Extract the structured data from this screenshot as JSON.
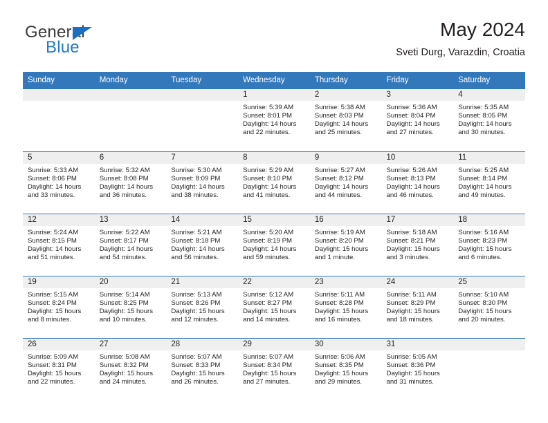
{
  "brand": {
    "name_part1": "General",
    "name_part2": "Blue",
    "triangle_icon": "blue-triangle-logo-mark",
    "color_dark": "#3b3b3b",
    "color_blue": "#2079c7"
  },
  "header": {
    "title": "May 2024",
    "subtitle": "Sveti Durg, Varazdin, Croatia"
  },
  "colors": {
    "header_blue": "#3478bc",
    "daynum_band": "#efefef",
    "text": "#231f20",
    "row_divider": "#3478bc"
  },
  "calendar": {
    "weekday_headers": [
      "Sunday",
      "Monday",
      "Tuesday",
      "Wednesday",
      "Thursday",
      "Friday",
      "Saturday"
    ],
    "weeks": [
      [
        {
          "day": "",
          "sunrise": "",
          "sunset": "",
          "daylight_line1": "",
          "daylight_line2": ""
        },
        {
          "day": "",
          "sunrise": "",
          "sunset": "",
          "daylight_line1": "",
          "daylight_line2": ""
        },
        {
          "day": "",
          "sunrise": "",
          "sunset": "",
          "daylight_line1": "",
          "daylight_line2": ""
        },
        {
          "day": "1",
          "sunrise": "Sunrise: 5:39 AM",
          "sunset": "Sunset: 8:01 PM",
          "daylight_line1": "Daylight: 14 hours",
          "daylight_line2": "and 22 minutes."
        },
        {
          "day": "2",
          "sunrise": "Sunrise: 5:38 AM",
          "sunset": "Sunset: 8:03 PM",
          "daylight_line1": "Daylight: 14 hours",
          "daylight_line2": "and 25 minutes."
        },
        {
          "day": "3",
          "sunrise": "Sunrise: 5:36 AM",
          "sunset": "Sunset: 8:04 PM",
          "daylight_line1": "Daylight: 14 hours",
          "daylight_line2": "and 27 minutes."
        },
        {
          "day": "4",
          "sunrise": "Sunrise: 5:35 AM",
          "sunset": "Sunset: 8:05 PM",
          "daylight_line1": "Daylight: 14 hours",
          "daylight_line2": "and 30 minutes."
        }
      ],
      [
        {
          "day": "5",
          "sunrise": "Sunrise: 5:33 AM",
          "sunset": "Sunset: 8:06 PM",
          "daylight_line1": "Daylight: 14 hours",
          "daylight_line2": "and 33 minutes."
        },
        {
          "day": "6",
          "sunrise": "Sunrise: 5:32 AM",
          "sunset": "Sunset: 8:08 PM",
          "daylight_line1": "Daylight: 14 hours",
          "daylight_line2": "and 36 minutes."
        },
        {
          "day": "7",
          "sunrise": "Sunrise: 5:30 AM",
          "sunset": "Sunset: 8:09 PM",
          "daylight_line1": "Daylight: 14 hours",
          "daylight_line2": "and 38 minutes."
        },
        {
          "day": "8",
          "sunrise": "Sunrise: 5:29 AM",
          "sunset": "Sunset: 8:10 PM",
          "daylight_line1": "Daylight: 14 hours",
          "daylight_line2": "and 41 minutes."
        },
        {
          "day": "9",
          "sunrise": "Sunrise: 5:27 AM",
          "sunset": "Sunset: 8:12 PM",
          "daylight_line1": "Daylight: 14 hours",
          "daylight_line2": "and 44 minutes."
        },
        {
          "day": "10",
          "sunrise": "Sunrise: 5:26 AM",
          "sunset": "Sunset: 8:13 PM",
          "daylight_line1": "Daylight: 14 hours",
          "daylight_line2": "and 46 minutes."
        },
        {
          "day": "11",
          "sunrise": "Sunrise: 5:25 AM",
          "sunset": "Sunset: 8:14 PM",
          "daylight_line1": "Daylight: 14 hours",
          "daylight_line2": "and 49 minutes."
        }
      ],
      [
        {
          "day": "12",
          "sunrise": "Sunrise: 5:24 AM",
          "sunset": "Sunset: 8:15 PM",
          "daylight_line1": "Daylight: 14 hours",
          "daylight_line2": "and 51 minutes."
        },
        {
          "day": "13",
          "sunrise": "Sunrise: 5:22 AM",
          "sunset": "Sunset: 8:17 PM",
          "daylight_line1": "Daylight: 14 hours",
          "daylight_line2": "and 54 minutes."
        },
        {
          "day": "14",
          "sunrise": "Sunrise: 5:21 AM",
          "sunset": "Sunset: 8:18 PM",
          "daylight_line1": "Daylight: 14 hours",
          "daylight_line2": "and 56 minutes."
        },
        {
          "day": "15",
          "sunrise": "Sunrise: 5:20 AM",
          "sunset": "Sunset: 8:19 PM",
          "daylight_line1": "Daylight: 14 hours",
          "daylight_line2": "and 59 minutes."
        },
        {
          "day": "16",
          "sunrise": "Sunrise: 5:19 AM",
          "sunset": "Sunset: 8:20 PM",
          "daylight_line1": "Daylight: 15 hours",
          "daylight_line2": "and 1 minute."
        },
        {
          "day": "17",
          "sunrise": "Sunrise: 5:18 AM",
          "sunset": "Sunset: 8:21 PM",
          "daylight_line1": "Daylight: 15 hours",
          "daylight_line2": "and 3 minutes."
        },
        {
          "day": "18",
          "sunrise": "Sunrise: 5:16 AM",
          "sunset": "Sunset: 8:23 PM",
          "daylight_line1": "Daylight: 15 hours",
          "daylight_line2": "and 6 minutes."
        }
      ],
      [
        {
          "day": "19",
          "sunrise": "Sunrise: 5:15 AM",
          "sunset": "Sunset: 8:24 PM",
          "daylight_line1": "Daylight: 15 hours",
          "daylight_line2": "and 8 minutes."
        },
        {
          "day": "20",
          "sunrise": "Sunrise: 5:14 AM",
          "sunset": "Sunset: 8:25 PM",
          "daylight_line1": "Daylight: 15 hours",
          "daylight_line2": "and 10 minutes."
        },
        {
          "day": "21",
          "sunrise": "Sunrise: 5:13 AM",
          "sunset": "Sunset: 8:26 PM",
          "daylight_line1": "Daylight: 15 hours",
          "daylight_line2": "and 12 minutes."
        },
        {
          "day": "22",
          "sunrise": "Sunrise: 5:12 AM",
          "sunset": "Sunset: 8:27 PM",
          "daylight_line1": "Daylight: 15 hours",
          "daylight_line2": "and 14 minutes."
        },
        {
          "day": "23",
          "sunrise": "Sunrise: 5:11 AM",
          "sunset": "Sunset: 8:28 PM",
          "daylight_line1": "Daylight: 15 hours",
          "daylight_line2": "and 16 minutes."
        },
        {
          "day": "24",
          "sunrise": "Sunrise: 5:11 AM",
          "sunset": "Sunset: 8:29 PM",
          "daylight_line1": "Daylight: 15 hours",
          "daylight_line2": "and 18 minutes."
        },
        {
          "day": "25",
          "sunrise": "Sunrise: 5:10 AM",
          "sunset": "Sunset: 8:30 PM",
          "daylight_line1": "Daylight: 15 hours",
          "daylight_line2": "and 20 minutes."
        }
      ],
      [
        {
          "day": "26",
          "sunrise": "Sunrise: 5:09 AM",
          "sunset": "Sunset: 8:31 PM",
          "daylight_line1": "Daylight: 15 hours",
          "daylight_line2": "and 22 minutes."
        },
        {
          "day": "27",
          "sunrise": "Sunrise: 5:08 AM",
          "sunset": "Sunset: 8:32 PM",
          "daylight_line1": "Daylight: 15 hours",
          "daylight_line2": "and 24 minutes."
        },
        {
          "day": "28",
          "sunrise": "Sunrise: 5:07 AM",
          "sunset": "Sunset: 8:33 PM",
          "daylight_line1": "Daylight: 15 hours",
          "daylight_line2": "and 26 minutes."
        },
        {
          "day": "29",
          "sunrise": "Sunrise: 5:07 AM",
          "sunset": "Sunset: 8:34 PM",
          "daylight_line1": "Daylight: 15 hours",
          "daylight_line2": "and 27 minutes."
        },
        {
          "day": "30",
          "sunrise": "Sunrise: 5:06 AM",
          "sunset": "Sunset: 8:35 PM",
          "daylight_line1": "Daylight: 15 hours",
          "daylight_line2": "and 29 minutes."
        },
        {
          "day": "31",
          "sunrise": "Sunrise: 5:05 AM",
          "sunset": "Sunset: 8:36 PM",
          "daylight_line1": "Daylight: 15 hours",
          "daylight_line2": "and 31 minutes."
        },
        {
          "day": "",
          "sunrise": "",
          "sunset": "",
          "daylight_line1": "",
          "daylight_line2": ""
        }
      ]
    ]
  }
}
